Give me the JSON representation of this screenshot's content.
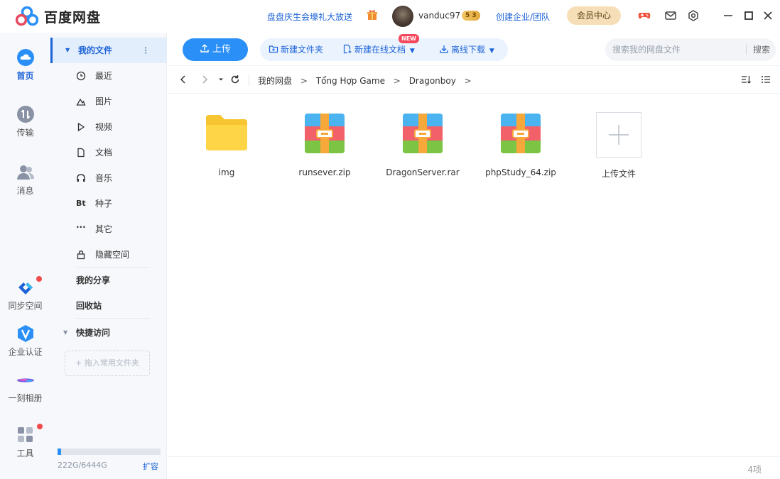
{
  "app": {
    "brand": "百度网盘",
    "promo_text": "盘盘庆生会壕礼大放送",
    "username": "vanduc97",
    "level_badge": "5 3",
    "enterprise_link": "创建企业/团队",
    "vip_button": "会员中心"
  },
  "rail": {
    "items": [
      {
        "label": "首页",
        "icon": "cloud-icon",
        "active": true
      },
      {
        "label": "传输",
        "icon": "transfer-icon"
      },
      {
        "label": "消息",
        "icon": "people-icon"
      },
      {
        "label": "同步空间",
        "icon": "sync-icon"
      },
      {
        "label": "企业认证",
        "icon": "verify-v-icon"
      },
      {
        "label": "一刻相册",
        "icon": "album-icon"
      },
      {
        "label": "工具",
        "icon": "tools-icon"
      }
    ]
  },
  "sidebar": {
    "my_files": "我的文件",
    "sub_items": [
      {
        "label": "最近",
        "icon": "clock-icon"
      },
      {
        "label": "图片",
        "icon": "image-icon"
      },
      {
        "label": "视频",
        "icon": "play-icon"
      },
      {
        "label": "文档",
        "icon": "document-icon"
      },
      {
        "label": "音乐",
        "icon": "headphones-icon"
      },
      {
        "label": "种子",
        "icon": "bt-icon"
      },
      {
        "label": "其它",
        "icon": "ellipsis-icon"
      },
      {
        "label": "隐藏空间",
        "icon": "lock-icon"
      }
    ],
    "bt_text": "Bt",
    "ellipsis_text": "···",
    "my_share": "我的分享",
    "recycle_bin": "回收站",
    "quick_access": "快捷访问",
    "drop_hint": "+ 拖入常用文件夹",
    "storage_text": "222G/6444G",
    "storage_fraction": 0.034,
    "expand_link": "扩容"
  },
  "toolbar": {
    "upload": "上传",
    "new_folder": "新建文件夹",
    "new_online_doc": "新建在线文档",
    "new_badge": "NEW",
    "offline_download": "离线下载",
    "search_placeholder": "搜索我的网盘文件",
    "search_button": "搜索"
  },
  "breadcrumb": {
    "items": [
      "我的网盘",
      "Tổng Hợp Game",
      "Dragonboy"
    ],
    "separator": ">"
  },
  "files": [
    {
      "name": "img",
      "type": "folder"
    },
    {
      "name": "runsever.zip",
      "type": "archive"
    },
    {
      "name": "DragonServer.rar",
      "type": "archive"
    },
    {
      "name": "phpStudy_64.zip",
      "type": "archive"
    }
  ],
  "upload_tile": "上传文件",
  "status": {
    "count": "4项"
  },
  "colors": {
    "accent": "#2a8ff7",
    "link": "#1d63d8",
    "badge_red": "#f5475c"
  }
}
